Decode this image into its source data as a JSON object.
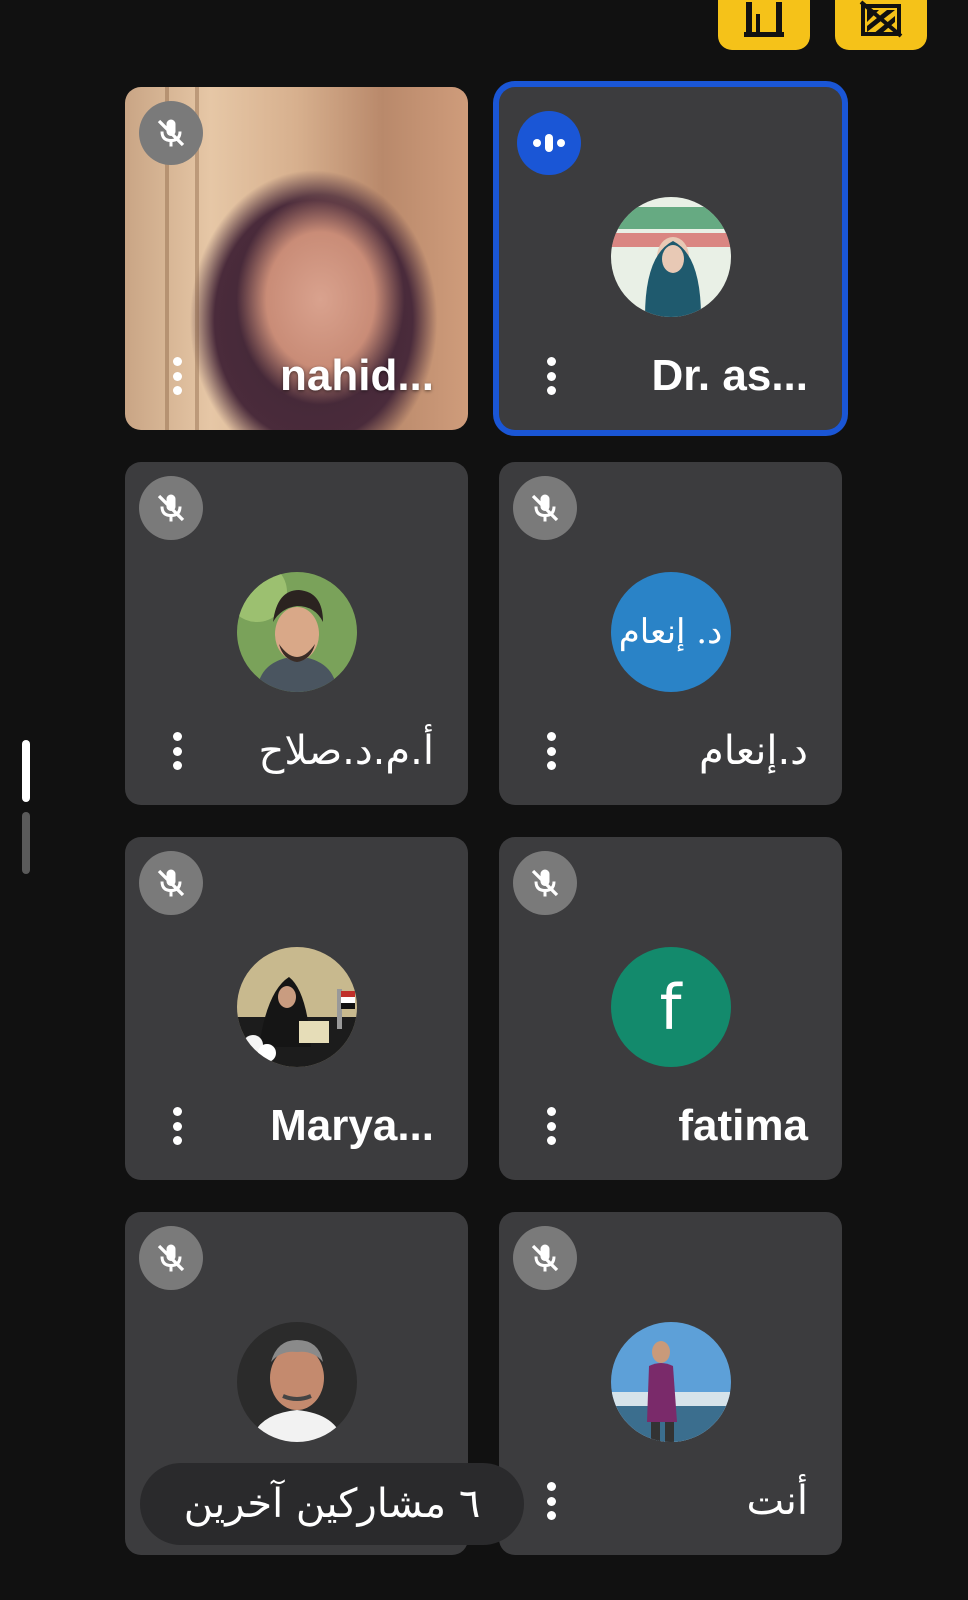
{
  "toolbar": {
    "buttons": [
      {
        "name": "layout-button",
        "icon": "grid-layout-icon"
      },
      {
        "name": "video-off-button",
        "icon": "video-off-icon"
      }
    ],
    "accent_color": "#f5c219"
  },
  "participants": [
    {
      "name": "nahid...",
      "mic": "muted",
      "avatar": "video-feed"
    },
    {
      "name": "Dr. as...",
      "mic": "speaking",
      "avatar": "photo"
    },
    {
      "name": "أ.م.د.صلاح",
      "mic": "muted",
      "avatar": "photo"
    },
    {
      "name": "د.إنعام",
      "mic": "muted",
      "avatar": "text",
      "avatar_text": "د. إنعام"
    },
    {
      "name": "Marya...",
      "mic": "muted",
      "avatar": "photo"
    },
    {
      "name": "fatima",
      "mic": "muted",
      "avatar": "letter",
      "avatar_letter": "f"
    },
    {
      "name": "",
      "mic": "muted",
      "avatar": "photo"
    },
    {
      "name": "أنت",
      "mic": "muted",
      "avatar": "photo"
    }
  ],
  "others_pill": {
    "label": "٦ مشاركين آخرين"
  },
  "colors": {
    "background": "#111111",
    "tile": "#3c3c3e",
    "speaking_border": "#1a56d6",
    "muted_badge": "#7a7a7a",
    "letter_avatar": "#138a6c"
  }
}
